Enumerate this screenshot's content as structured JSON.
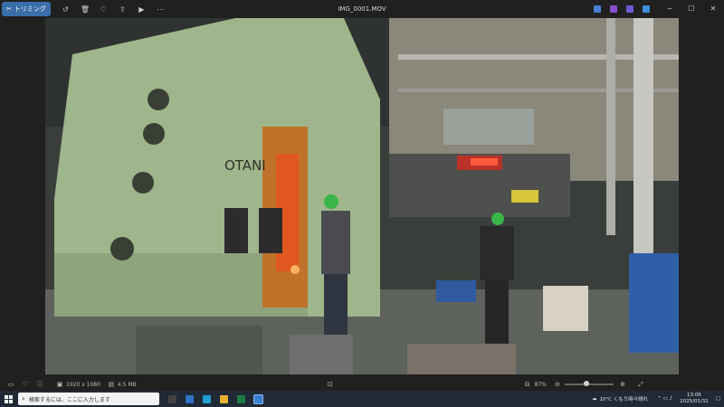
{
  "toolbar": {
    "trim_label": "トリミング"
  },
  "window": {
    "title": "IMG_0001.MOV"
  },
  "video": {
    "machine_brand": "OTANI"
  },
  "statusbar": {
    "resolution": "1920 x 1080",
    "filesize": "4.5 MB",
    "zoom": "87%",
    "zoom_level": 0.45
  },
  "taskbar": {
    "search_placeholder": "検索するには、ここに入力します",
    "weather": "10°C くもり時々晴れ",
    "time": "13:06",
    "date": "2025/01/31"
  },
  "colors": {
    "accent": "#3a6ea8",
    "taskbar": "#1f2a36"
  }
}
